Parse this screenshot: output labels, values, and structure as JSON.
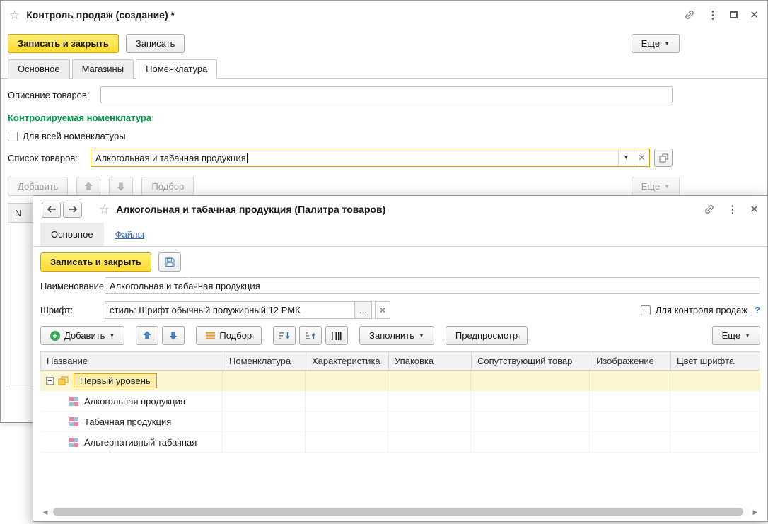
{
  "colors": {
    "accent_yellow": "#FFD92D",
    "focus_border": "#D89F00",
    "green_title": "#009846",
    "link_blue": "#2A6FC9",
    "group_row_yellow": "#FCF6D4"
  },
  "back": {
    "title": "Контроль продаж (создание) *",
    "btn_save_close": "Записать и закрыть",
    "btn_save": "Записать",
    "btn_more": "Еще",
    "tabs": [
      "Основное",
      "Магазины",
      "Номенклатура"
    ],
    "description_label": "Описание товаров:",
    "section_title": "Контролируемая номенклатура",
    "all_nomenclature_label": "Для всей номенклатуры",
    "goods_list_label": "Список товаров:",
    "goods_list_value": "Алкогольная и табачная продукция",
    "btn_add": "Добавить",
    "btn_pick": "Подбор",
    "col_n": "N"
  },
  "front": {
    "title": "Алкогольная и табачная продукция (Палитра товаров)",
    "nav_main": "Основное",
    "nav_files": "Файлы",
    "btn_save_close": "Записать и закрыть",
    "name_label": "Наименование:",
    "name_value": "Алкогольная и табачная продукция",
    "font_label": "Шрифт:",
    "font_value": "стиль: Шрифт обычный полужирный 12 РМК",
    "font_more": "...",
    "sales_control_label": "Для контроля продаж",
    "help": "?",
    "btn_add": "Добавить",
    "btn_pick": "Подбор",
    "btn_fill": "Заполнить",
    "btn_preview": "Предпросмотр",
    "btn_more": "Еще",
    "columns": [
      "Название",
      "Номенклатура",
      "Характеристика",
      "Упаковка",
      "Сопутствующий товар",
      "Изображение",
      "Цвет шрифта"
    ],
    "rows": [
      {
        "name": "Первый уровень",
        "type": "group"
      },
      {
        "name": "Алкогольная продукция",
        "type": "item"
      },
      {
        "name": "Табачная продукция",
        "type": "item"
      },
      {
        "name": "Альтернативный табачная",
        "type": "item"
      }
    ]
  }
}
